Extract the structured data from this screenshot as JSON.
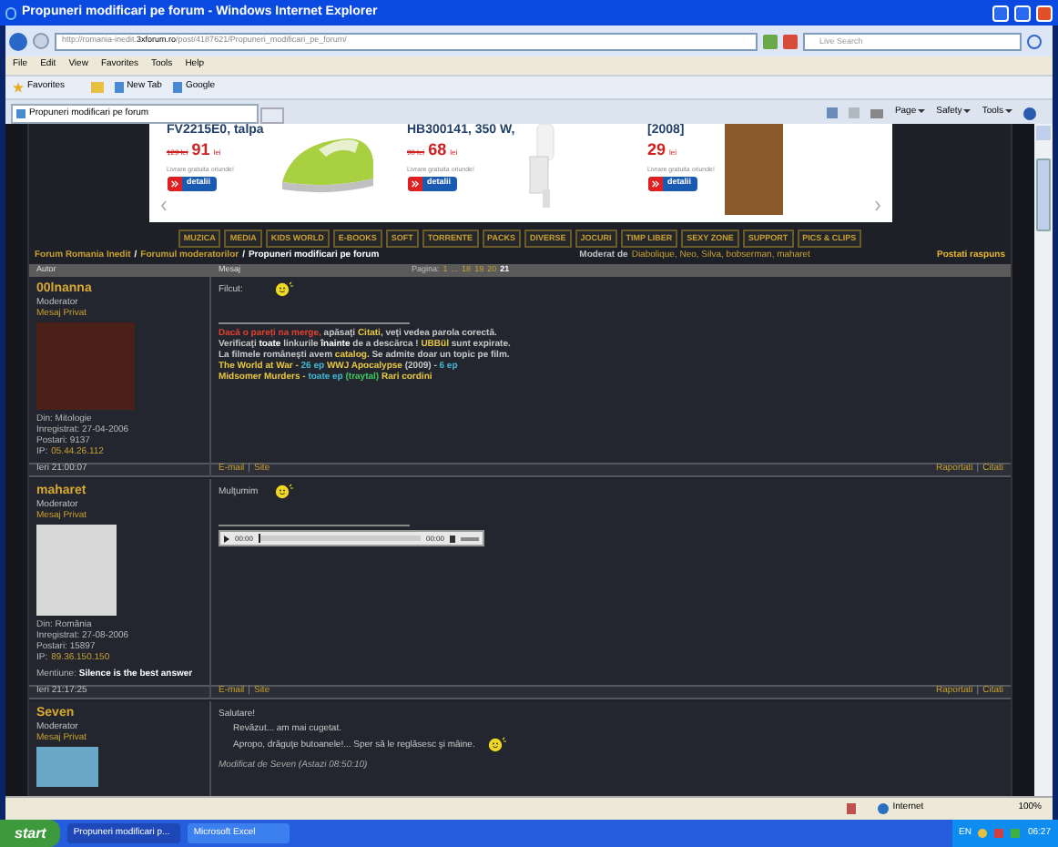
{
  "window": {
    "title": "Propuneri modificari pe forum - Windows Internet Explorer"
  },
  "address_bar": {
    "url_prefix": "http://romania-inedit.",
    "url_domain": "3xforum.ro",
    "url_path": "/post/4187621/Propuneri_modificari_pe_forum/",
    "search_placeholder": "Live Search"
  },
  "menu": [
    "File",
    "Edit",
    "View",
    "Favorites",
    "Tools",
    "Help"
  ],
  "favorites_bar": {
    "favorites": "Favorites",
    "links": [
      "New Tab",
      "Google"
    ]
  },
  "tabs": [
    {
      "label": "Propuneri modificari pe forum",
      "selected": true
    }
  ],
  "command_bar": [
    "Page",
    "Safety",
    "Tools"
  ],
  "ad": {
    "products": [
      {
        "title": "FV2215E0, talpa",
        "old_price": "129 lei",
        "price": "91",
        "currency": "lei",
        "shipping": "Livrare gratuita oriunde!",
        "button": "detalii"
      },
      {
        "title": "HB300141, 350 W,",
        "old_price": "90 lei",
        "price": "68",
        "currency": "lei",
        "shipping": "Livrare gratuita oriunde!",
        "button": "detalii"
      },
      {
        "title": "[2008]",
        "price": "29",
        "currency": "lei",
        "shipping": "Livrare gratuita oriunde!",
        "button": "detalii"
      }
    ]
  },
  "nav": [
    "MUZICA",
    "MEDIA",
    "KIDS WORLD",
    "E-BOOKS",
    "SOFT",
    "TORRENTE",
    "PACKS",
    "DIVERSE",
    "JOCURI",
    "TIMP LIBER",
    "SEXY ZONE",
    "SUPPORT",
    "PICS & CLIPS"
  ],
  "breadcrumb": {
    "items": [
      "Forum Romania Inedit",
      "Forumul moderatorilor",
      "Propuneri modificari pe forum"
    ],
    "separator": "/"
  },
  "moderators": {
    "label": "Moderat de",
    "names": "Diabolique, Neo, Silva, bobserman, maharet"
  },
  "reply": "Postati raspuns",
  "table": {
    "columns": [
      "Autor",
      "Mesaj"
    ],
    "pagination": {
      "label": "Pagina:",
      "pages": [
        {
          "label": "1",
          "selected": false
        },
        {
          "label": "...",
          "selected": false
        },
        {
          "label": "18",
          "selected": false
        },
        {
          "label": "19",
          "selected": false
        },
        {
          "label": "20",
          "selected": false
        },
        {
          "label": "21",
          "selected": true
        }
      ]
    }
  },
  "link_separator": "|",
  "posts": [
    {
      "author": "00lnanna",
      "rank": "Moderator",
      "pm": "Mesaj Privat",
      "details": [
        "Din: Mitologie",
        "Inregistrat: 27-04-2006",
        "Postari: 9137"
      ],
      "ip_label": "IP:",
      "ip": "05.44.26.112",
      "body": [
        {
          "kind": "text",
          "text": "Filcut:"
        },
        {
          "kind": "smiley"
        },
        {
          "kind": "rule"
        },
        {
          "kind": "signature",
          "lines": [
            [
              {
                "text": "Dacă o pareți na merge,",
                "color": "#e04030"
              },
              {
                "text": " apăsaţi ",
                "color": "#c8c8c8"
              },
              {
                "text": "Citati",
                "color": "#e8c840"
              },
              {
                "text": ", veţi vedea parola corectă.",
                "color": "#c8c8c8"
              }
            ],
            [
              {
                "text": "Verificaţi ",
                "color": "#c8c8c8"
              },
              {
                "text": "toate",
                "color": "#ffffff"
              },
              {
                "text": " linkurile ",
                "color": "#c8c8c8"
              },
              {
                "text": "înainte",
                "color": "#ffffff"
              },
              {
                "text": " de a descărca ! ",
                "color": "#c8c8c8"
              },
              {
                "text": "UBBül",
                "color": "#e8c840"
              },
              {
                "text": " sunt expirate.",
                "color": "#c8c8c8"
              }
            ],
            [
              {
                "text": "La filmele româneşti avem ",
                "color": "#c8c8c8"
              },
              {
                "text": "catalog",
                "color": "#e8c840"
              },
              {
                "text": ". Se admite doar un topic pe film.",
                "color": "#c8c8c8"
              }
            ],
            [
              {
                "text": "The World at War - ",
                "color": "#e8c840"
              },
              {
                "text": "26 ep",
                "color": "#40b8d0"
              },
              {
                "text": " WWJ Apocalypse",
                "color": "#e8c840"
              },
              {
                "text": " (2009) - ",
                "color": "#c8c8c8"
              },
              {
                "text": "6 ep",
                "color": "#40b8d0"
              }
            ],
            [
              {
                "text": "Midsomer Murders - ",
                "color": "#e8c840"
              },
              {
                "text": "toate ep",
                "color": "#40b8d0"
              },
              {
                "text": " (traytal)",
                "color": "#40c860"
              },
              {
                "text": " Rari cordini",
                "color": "#e8c840"
              }
            ]
          ]
        }
      ],
      "footer": {
        "time": "Ieri 21:00:07",
        "links": [
          "E-mail",
          "Site"
        ],
        "actions": [
          "Raportati",
          "Citati"
        ]
      }
    },
    {
      "author": "maharet",
      "rank": "Moderator",
      "pm": "Mesaj Privat",
      "details": [
        "Din: România",
        "Inregistrat: 27-08-2006",
        "Postari: 15897"
      ],
      "ip_label": "IP:",
      "ip": "89.36.150.150",
      "mention_label": "Mentiune:",
      "mention": "Silence is the best answer",
      "body": [
        {
          "kind": "text",
          "text": "Mulţumim"
        },
        {
          "kind": "smiley"
        },
        {
          "kind": "rule"
        },
        {
          "kind": "audio",
          "elapsed": "00:00",
          "duration": "00:00",
          "level": 0
        }
      ],
      "footer": {
        "time": "Ieri 21:17:25",
        "links": [
          "E-mail",
          "Site"
        ],
        "actions": [
          "Raportati",
          "Citati"
        ]
      }
    },
    {
      "author": "Seven",
      "rank": "Moderator",
      "pm": "Mesaj Privat",
      "body": [
        {
          "kind": "text",
          "text": "Salutare!"
        },
        {
          "kind": "indent",
          "text": "Revăzut... am mai cugetat."
        },
        {
          "kind": "indent_smiley",
          "text": "Apropo, drăguţe butoanele!... Sper să le reglăsesc şi mâine."
        },
        {
          "kind": "edit_note",
          "text": "Modificat de Seven (Astazi 08:50:10)"
        }
      ]
    }
  ],
  "status_bar": {
    "zone": "Internet",
    "zoom": "100%"
  },
  "taskbar": {
    "start": "start",
    "tasks": [
      {
        "label": "Propuneri modificari p...",
        "selected": true
      },
      {
        "label": "Microsoft Excel",
        "selected": false
      }
    ],
    "lang": "EN",
    "clock": "06:27"
  }
}
